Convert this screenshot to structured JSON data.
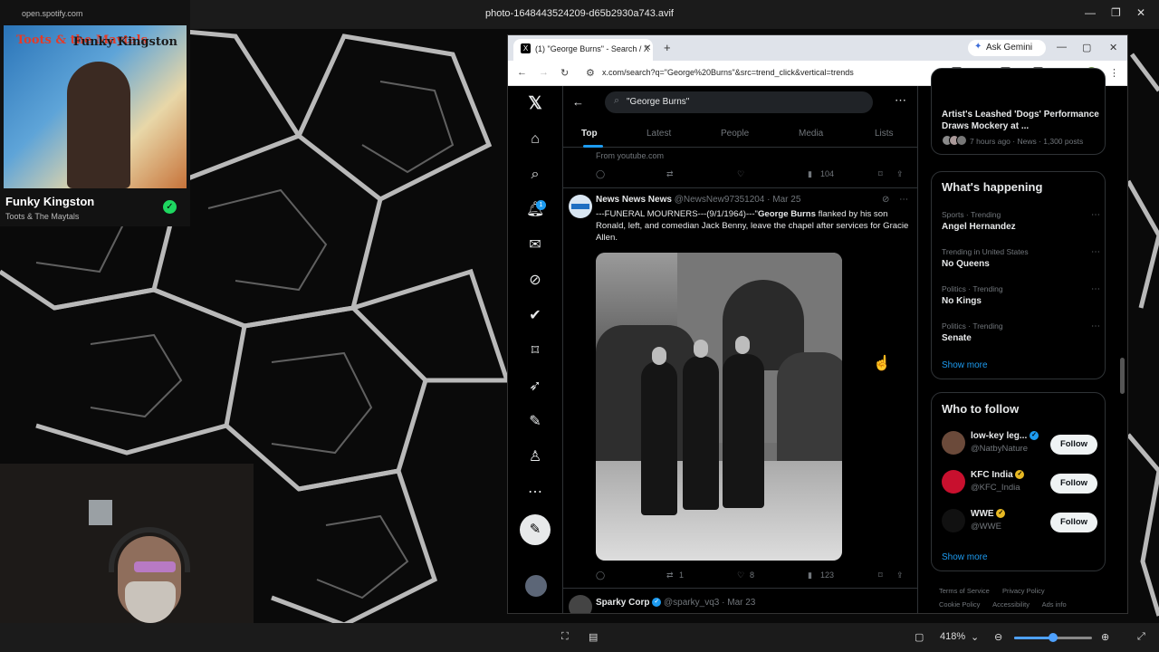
{
  "viewer": {
    "title": "photo-1648443524209-d65b2930a743.avif",
    "zoom": "418%",
    "zoom_fraction": 0.5
  },
  "spotify": {
    "url": "open.spotify.com",
    "art_text_left": "Toots & the Maytals",
    "art_text_right": "Funky Kingston",
    "track": "Funky Kingston",
    "artist": "Toots & The Maytals"
  },
  "browser": {
    "tab_title": "(1) \"George Burns\" - Search / X",
    "gemini": "Ask Gemini",
    "url": "x.com/search?q=\"George%20Burns\"&src=trend_click&vertical=trends"
  },
  "x": {
    "notif_count": "1",
    "search_query": "\"George Burns\"",
    "tabs": [
      "Top",
      "Latest",
      "People",
      "Media",
      "Lists"
    ],
    "prev_post": {
      "source": "From youtube.com",
      "views": "104"
    },
    "tweet": {
      "name": "News News News",
      "handle": "@NewsNew97351204",
      "date": "Mar 25",
      "text_pre": "---FUNERAL MOURNERS---(9/1/1964)---\"",
      "text_bold": "George Burns",
      "text_post": " flanked by his son Ronald, left, and comedian Jack Benny, leave the chapel after services for Gracie Allen.",
      "retweets": "1",
      "likes": "8",
      "views": "123"
    },
    "next_tweet": {
      "name": "Sparky Corp",
      "handle": "@sparky_vq3",
      "date": "Mar 23"
    }
  },
  "sidebar": {
    "top_card": {
      "title": "Artist's Leashed 'Dogs' Performance Draws Mockery at ...",
      "meta": "7 hours ago · News · 1,300 posts"
    },
    "whats_happening": {
      "title": "What's happening",
      "trends": [
        {
          "meta": "Sports · Trending",
          "name": "Angel Hernandez"
        },
        {
          "meta": "Trending in United States",
          "name": "No Queens"
        },
        {
          "meta": "Politics · Trending",
          "name": "No Kings"
        },
        {
          "meta": "Politics · Trending",
          "name": "Senate"
        }
      ],
      "show_more": "Show more"
    },
    "who_to_follow": {
      "title": "Who to follow",
      "accounts": [
        {
          "name": "low-key leg...",
          "handle": "@NatbyNature",
          "follow": "Follow",
          "badge_color": "#1d9bf0",
          "avatar_color": "#6b4a3a"
        },
        {
          "name": "KFC India",
          "handle": "@KFC_India",
          "follow": "Follow",
          "badge_color": "#e8b923",
          "avatar_color": "#c8102e"
        },
        {
          "name": "WWE",
          "handle": "@WWE",
          "follow": "Follow",
          "badge_color": "#e8b923",
          "avatar_color": "#111111"
        }
      ],
      "show_more": "Show more"
    },
    "footer": [
      "Terms of Service",
      "Privacy Policy",
      "Cookie Policy",
      "Accessibility",
      "Ads info"
    ]
  }
}
